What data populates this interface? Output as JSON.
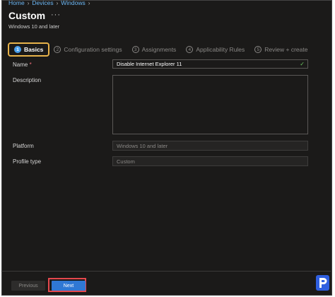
{
  "breadcrumb": {
    "items": [
      "Home",
      "Devices",
      "Windows"
    ]
  },
  "header": {
    "title": "Custom",
    "more_label": "···",
    "subtitle": "Windows 10 and later"
  },
  "steps": [
    {
      "num": "1",
      "label": "Basics"
    },
    {
      "num": "2",
      "label": "Configuration settings"
    },
    {
      "num": "3",
      "label": "Assignments"
    },
    {
      "num": "4",
      "label": "Applicability Rules"
    },
    {
      "num": "5",
      "label": "Review + create"
    }
  ],
  "form": {
    "name_label": "Name",
    "required_mark": "*",
    "name_value": "Disable Internet Explorer 11",
    "description_label": "Description",
    "description_value": "",
    "platform_label": "Platform",
    "platform_value": "Windows 10 and later",
    "profile_type_label": "Profile type",
    "profile_type_value": "Custom"
  },
  "footer": {
    "previous_label": "Previous",
    "next_label": "Next"
  },
  "colors": {
    "accent": "#2f78d4",
    "highlight_active_step": "#e8b34a",
    "highlight_next": "#e5484d",
    "link": "#6cb8f6"
  }
}
